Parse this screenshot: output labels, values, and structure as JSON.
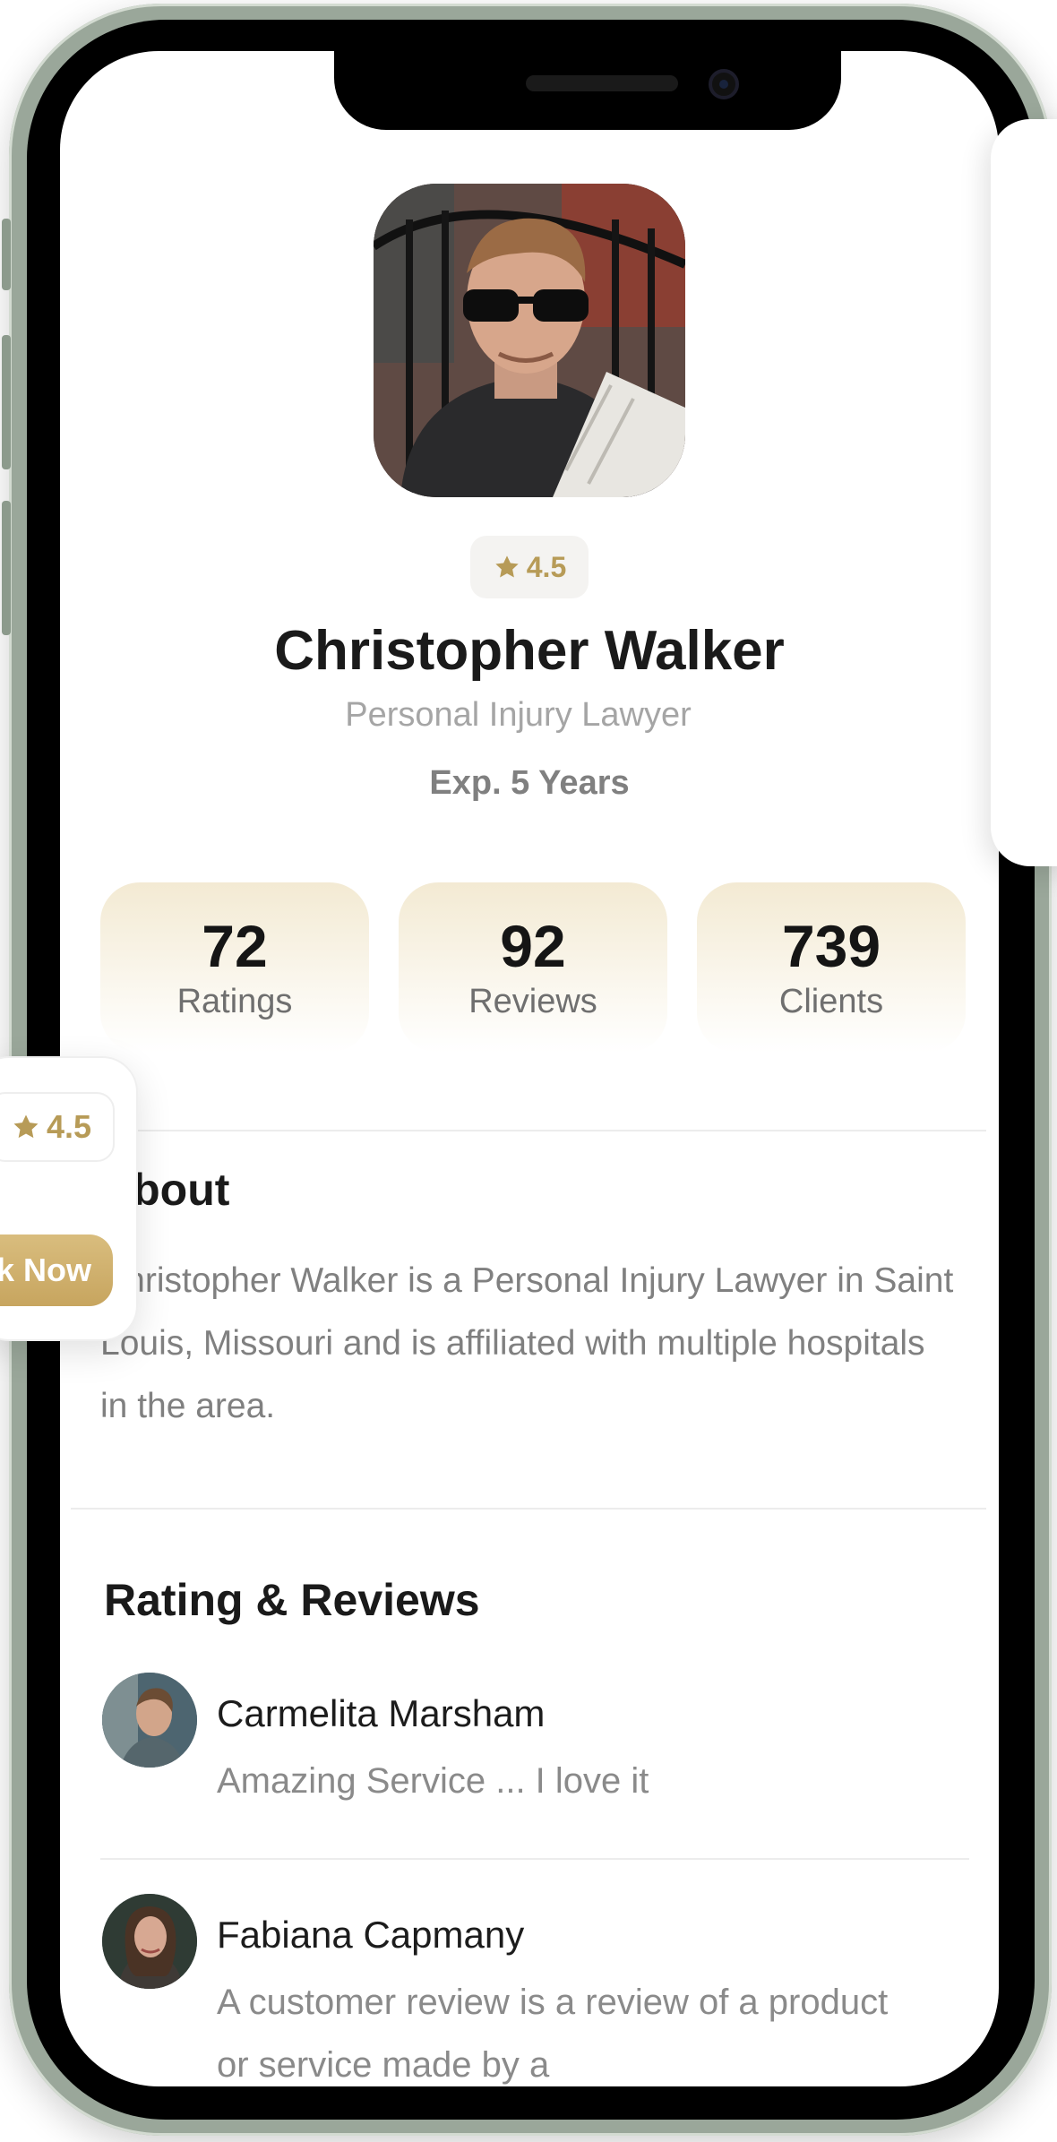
{
  "profile": {
    "rating": "4.5",
    "name": "Christopher Walker",
    "title": "Personal Injury Lawyer",
    "experience": "Exp. 5 Years"
  },
  "stats": [
    {
      "value": "72",
      "label": "Ratings"
    },
    {
      "value": "92",
      "label": "Reviews"
    },
    {
      "value": "739",
      "label": "Clients"
    }
  ],
  "about": {
    "heading": "About",
    "text": "Christopher Walker is a Personal Injury Lawyer in Saint Louis, Missouri and is affiliated with multiple hospitals in the area."
  },
  "reviews": {
    "heading": "Rating & Reviews",
    "items": [
      {
        "name": "Carmelita Marsham",
        "comment": "Amazing Service ... I love it"
      },
      {
        "name": "Fabiana Capmany",
        "comment": "A customer review is a review of a product or service made by a"
      }
    ]
  },
  "overlay_card": {
    "rating": "4.5",
    "button_label": "Book Now"
  },
  "colors": {
    "accent": "#b79b57",
    "button": "#c7a55f",
    "stat_card": "#f3ead3"
  }
}
